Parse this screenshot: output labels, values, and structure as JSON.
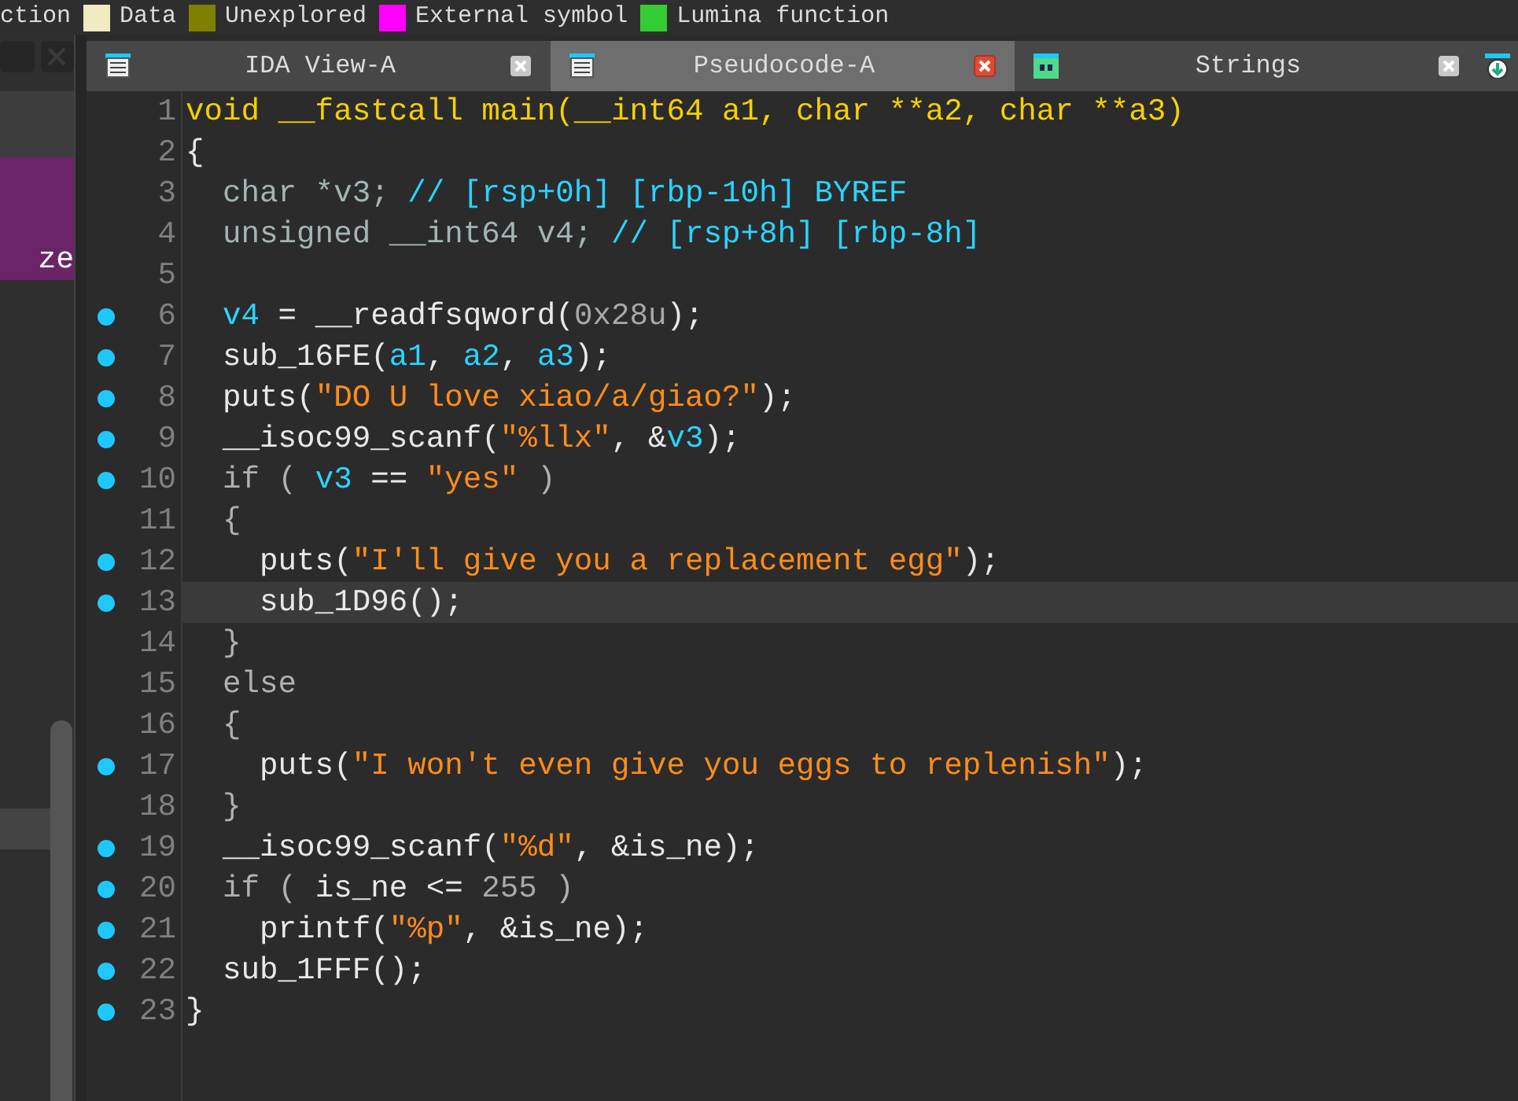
{
  "legend": [
    {
      "label": "ction"
    },
    {
      "label": "Data",
      "color": "#f0ebc0"
    },
    {
      "label": "Unexplored",
      "color": "#808000"
    },
    {
      "label": "External symbol",
      "color": "#ff00ff"
    },
    {
      "label": "Lumina function",
      "color": "#33cc33"
    }
  ],
  "side_panel": {
    "row_text": "ze"
  },
  "tabs": [
    {
      "label": "IDA View-A",
      "kind": "listing",
      "selected": false
    },
    {
      "label": "Pseudocode-A",
      "kind": "listing",
      "selected": true
    },
    {
      "label": "Strings",
      "kind": "strings",
      "selected": false
    },
    {
      "kind": "cut",
      "selected": false
    }
  ],
  "code": [
    {
      "number": "1",
      "marker": false,
      "highlighted": false,
      "tokens": [
        {
          "text": "void __fastcall main(__int64 a1, char **a2, char **a3)",
          "kind": "header"
        }
      ]
    },
    {
      "number": "2",
      "marker": false,
      "highlighted": false,
      "tokens": [
        {
          "text": "{",
          "kind": "plain"
        }
      ]
    },
    {
      "number": "3",
      "marker": false,
      "highlighted": false,
      "tokens": [
        {
          "text": "  char *v3; ",
          "kind": "type"
        },
        {
          "text": "// [rsp+0h] [rbp-10h] BYREF",
          "kind": "comment"
        }
      ]
    },
    {
      "number": "4",
      "marker": false,
      "highlighted": false,
      "tokens": [
        {
          "text": "  unsigned __int64 v4; ",
          "kind": "type"
        },
        {
          "text": "// [rsp+8h] [rbp-8h]",
          "kind": "comment"
        }
      ]
    },
    {
      "number": "5",
      "marker": false
    },
    {
      "number": "6",
      "marker": true,
      "highlighted": false,
      "tokens": [
        {
          "text": "  v4",
          "kind": "var"
        },
        {
          "text": " = __readfsqword(",
          "kind": "plain"
        },
        {
          "text": "0x28u",
          "kind": "num"
        },
        {
          "text": ");",
          "kind": "plain"
        }
      ]
    },
    {
      "number": "7",
      "marker": true,
      "highlighted": false,
      "tokens": [
        {
          "text": "  sub_16FE(",
          "kind": "plain"
        },
        {
          "text": "a1",
          "kind": "var"
        },
        {
          "text": ", ",
          "kind": "plain"
        },
        {
          "text": "a2",
          "kind": "var"
        },
        {
          "text": ", ",
          "kind": "plain"
        },
        {
          "text": "a3",
          "kind": "var"
        },
        {
          "text": ");",
          "kind": "plain"
        }
      ]
    },
    {
      "number": "8",
      "marker": true,
      "highlighted": false,
      "tokens": [
        {
          "text": "  puts(",
          "kind": "plain"
        },
        {
          "text": "\"DO U love xiao/a/giao?\"",
          "kind": "str"
        },
        {
          "text": ");",
          "kind": "plain"
        }
      ]
    },
    {
      "number": "9",
      "marker": true,
      "highlighted": false,
      "tokens": [
        {
          "text": "  __isoc99_scanf(",
          "kind": "plain"
        },
        {
          "text": "\"%llx\"",
          "kind": "str"
        },
        {
          "text": ", &",
          "kind": "plain"
        },
        {
          "text": "v3",
          "kind": "var"
        },
        {
          "text": ");",
          "kind": "plain"
        }
      ]
    },
    {
      "number": "10",
      "marker": true,
      "highlighted": false,
      "tokens": [
        {
          "text": "  if ( ",
          "kind": "kw"
        },
        {
          "text": "v3",
          "kind": "var"
        },
        {
          "text": " == ",
          "kind": "plain"
        },
        {
          "text": "\"yes\"",
          "kind": "str"
        },
        {
          "text": " )",
          "kind": "kw"
        }
      ]
    },
    {
      "number": "11",
      "marker": false,
      "highlighted": false,
      "tokens": [
        {
          "text": "  {",
          "kind": "kw"
        }
      ]
    },
    {
      "number": "12",
      "marker": true,
      "highlighted": false,
      "tokens": [
        {
          "text": "    puts(",
          "kind": "plain"
        },
        {
          "text": "\"I'll give you a replacement egg\"",
          "kind": "str"
        },
        {
          "text": ");",
          "kind": "plain"
        }
      ]
    },
    {
      "number": "13",
      "marker": true,
      "highlighted": true,
      "tokens": [
        {
          "text": "    sub_1D96();",
          "kind": "plain"
        }
      ]
    },
    {
      "number": "14",
      "marker": false,
      "highlighted": false,
      "tokens": [
        {
          "text": "  }",
          "kind": "kw"
        }
      ]
    },
    {
      "number": "15",
      "marker": false,
      "highlighted": false,
      "tokens": [
        {
          "text": "  else",
          "kind": "kw"
        }
      ]
    },
    {
      "number": "16",
      "marker": false,
      "highlighted": false,
      "tokens": [
        {
          "text": "  {",
          "kind": "kw"
        }
      ]
    },
    {
      "number": "17",
      "marker": true,
      "highlighted": false,
      "tokens": [
        {
          "text": "    puts(",
          "kind": "plain"
        },
        {
          "text": "\"I won't even give you eggs to replenish\"",
          "kind": "str"
        },
        {
          "text": ");",
          "kind": "plain"
        }
      ]
    },
    {
      "number": "18",
      "marker": false,
      "highlighted": false,
      "tokens": [
        {
          "text": "  }",
          "kind": "kw"
        }
      ]
    },
    {
      "number": "19",
      "marker": true,
      "highlighted": false,
      "tokens": [
        {
          "text": "  __isoc99_scanf(",
          "kind": "plain"
        },
        {
          "text": "\"%d\"",
          "kind": "str"
        },
        {
          "text": ", &is_ne);",
          "kind": "plain"
        }
      ]
    },
    {
      "number": "20",
      "marker": true,
      "highlighted": false,
      "tokens": [
        {
          "text": "  if ( ",
          "kind": "kw"
        },
        {
          "text": "is_ne <= ",
          "kind": "plain"
        },
        {
          "text": "255",
          "kind": "num"
        },
        {
          "text": " )",
          "kind": "kw"
        }
      ]
    },
    {
      "number": "21",
      "marker": true,
      "highlighted": false,
      "tokens": [
        {
          "text": "    printf(",
          "kind": "plain"
        },
        {
          "text": "\"%p\"",
          "kind": "str"
        },
        {
          "text": ", &is_ne);",
          "kind": "plain"
        }
      ]
    },
    {
      "number": "22",
      "marker": true,
      "highlighted": false,
      "tokens": [
        {
          "text": "  sub_1FFF();",
          "kind": "plain"
        }
      ]
    },
    {
      "number": "23",
      "marker": true,
      "highlighted": false,
      "tokens": [
        {
          "text": "}",
          "kind": "plain"
        }
      ]
    }
  ]
}
